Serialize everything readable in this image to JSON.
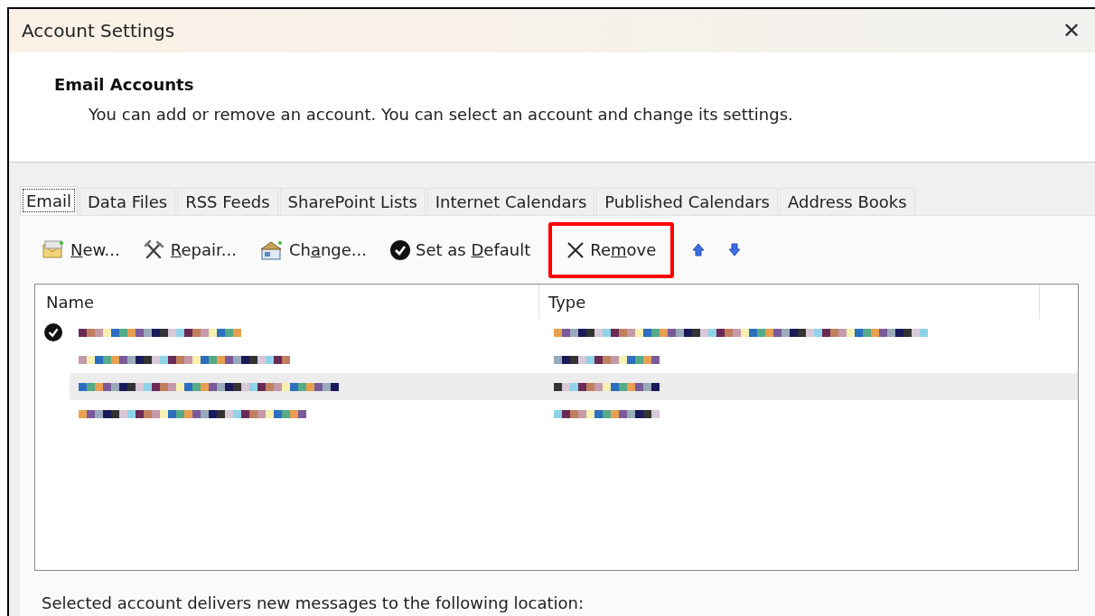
{
  "window": {
    "title": "Account Settings",
    "close": "✕"
  },
  "header": {
    "title": "Email Accounts",
    "description": "You can add or remove an account. You can select an account and change its settings."
  },
  "tabs": [
    {
      "label": "Email",
      "selected": true
    },
    {
      "label": "Data Files",
      "selected": false
    },
    {
      "label": "RSS Feeds",
      "selected": false
    },
    {
      "label": "SharePoint Lists",
      "selected": false
    },
    {
      "label": "Internet Calendars",
      "selected": false
    },
    {
      "label": "Published Calendars",
      "selected": false
    },
    {
      "label": "Address Books",
      "selected": false
    }
  ],
  "toolbar": [
    {
      "kind": "new",
      "label": {
        "key": "N",
        "after": "ew..."
      },
      "highlighted": false
    },
    {
      "kind": "repair",
      "label": {
        "key": "R",
        "after": "epair..."
      },
      "highlighted": false
    },
    {
      "kind": "change",
      "label": {
        "before": "Ch",
        "key": "a",
        "after": "nge..."
      },
      "highlighted": false
    },
    {
      "kind": "default",
      "label": {
        "before": "Set as ",
        "key": "D",
        "after": "efault"
      },
      "highlighted": false
    },
    {
      "kind": "remove",
      "label": {
        "before": "Re",
        "key": "m",
        "after": "ove"
      },
      "highlighted": true
    },
    {
      "kind": "up",
      "highlighted": false
    },
    {
      "kind": "down",
      "highlighted": false
    }
  ],
  "table": {
    "columns": [
      "Name",
      "Type"
    ],
    "rows": [
      {
        "default": true,
        "selected": false
      },
      {
        "default": false,
        "selected": false
      },
      {
        "default": false,
        "selected": true
      },
      {
        "default": false,
        "selected": false
      }
    ]
  },
  "footer": {
    "text": "Selected account delivers new messages to the following location:"
  }
}
